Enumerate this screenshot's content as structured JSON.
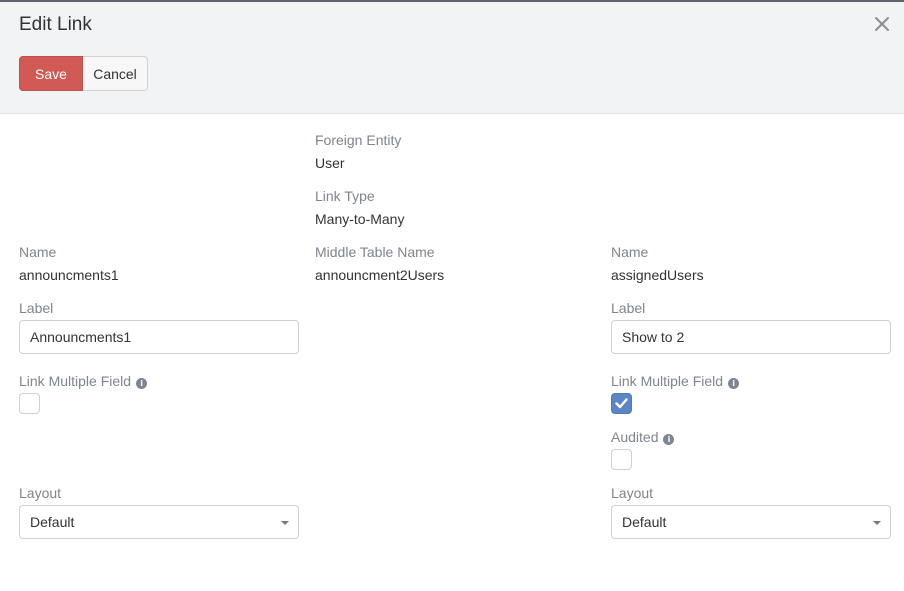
{
  "modal": {
    "title": "Edit Link",
    "close_icon": "close-icon"
  },
  "toolbar": {
    "save_label": "Save",
    "cancel_label": "Cancel"
  },
  "center": {
    "foreign_entity_label": "Foreign Entity",
    "foreign_entity_value": "User",
    "link_type_label": "Link Type",
    "link_type_value": "Many-to-Many",
    "middle_table_label": "Middle Table Name",
    "middle_table_value": "announcment2Users"
  },
  "left": {
    "name_label": "Name",
    "name_value": "announcments1",
    "label_label": "Label",
    "label_value": "Announcments1",
    "link_multiple_label": "Link Multiple Field",
    "link_multiple_checked": false,
    "layout_label": "Layout",
    "layout_value": "Default"
  },
  "right": {
    "name_label": "Name",
    "name_value": "assignedUsers",
    "label_label": "Label",
    "label_value": "Show to 2",
    "link_multiple_label": "Link Multiple Field",
    "link_multiple_checked": true,
    "audited_label": "Audited",
    "audited_checked": false,
    "layout_label": "Layout",
    "layout_value": "Default"
  },
  "colors": {
    "save_button": "#d25a55",
    "checkbox_checked": "#5b86c5",
    "label_text": "#7d8590"
  }
}
